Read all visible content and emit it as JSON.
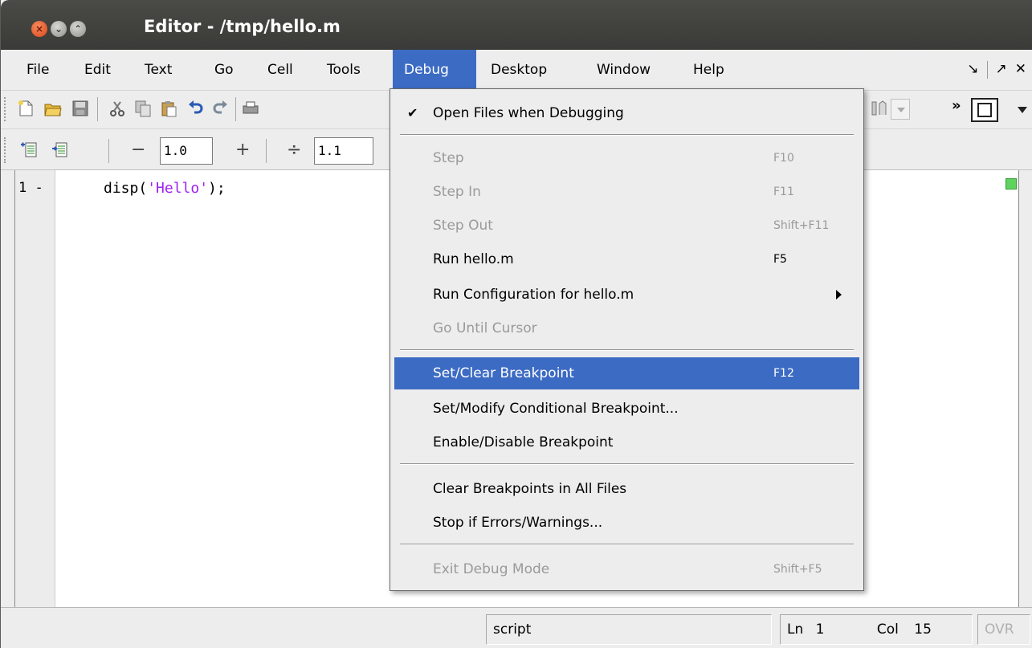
{
  "window": {
    "title": "Editor - /tmp/hello.m"
  },
  "menubar": {
    "items": [
      {
        "label": "File"
      },
      {
        "label": "Edit"
      },
      {
        "label": "Text"
      },
      {
        "label": "Go"
      },
      {
        "label": "Cell"
      },
      {
        "label": "Tools"
      },
      {
        "label": "Debug"
      },
      {
        "label": "Desktop"
      },
      {
        "label": "Window"
      },
      {
        "label": "Help"
      }
    ],
    "dock_icon": "↘",
    "undock_icon": "↗",
    "close_icon": "✕"
  },
  "toolbar2": {
    "decrement": "−",
    "increment": "+",
    "divide": "÷",
    "field1": "1.0",
    "field2": "1.1"
  },
  "toolbar1": {
    "overflow": "»"
  },
  "editor": {
    "line_number": "1",
    "line_marker": "-",
    "code_prefix": "disp(",
    "code_string": "'Hello'",
    "code_suffix": ");"
  },
  "debug_menu": {
    "check_mark": "✔",
    "open_files": "Open Files when Debugging",
    "step": "Step",
    "step_acc": "F10",
    "step_in": "Step In",
    "step_in_acc": "F11",
    "step_out": "Step Out",
    "step_out_acc": "Shift+F11",
    "run": "Run hello.m",
    "run_acc": "F5",
    "run_config": "Run Configuration for hello.m",
    "go_until": "Go Until Cursor",
    "set_clear": "Set/Clear Breakpoint",
    "set_clear_acc": "F12",
    "set_modify": "Set/Modify Conditional Breakpoint...",
    "enable_disable": "Enable/Disable Breakpoint",
    "clear_all": "Clear Breakpoints in All Files",
    "stop_if": "Stop if Errors/Warnings...",
    "exit_debug": "Exit Debug Mode",
    "exit_debug_acc": "Shift+F5"
  },
  "statusbar": {
    "mode": "script",
    "ln_label": "Ln",
    "ln_value": "1",
    "col_label": "Col",
    "col_value": "15",
    "ovr": "OVR"
  },
  "colors": {
    "accent": "#3c6bc4",
    "string": "#a020f0"
  }
}
